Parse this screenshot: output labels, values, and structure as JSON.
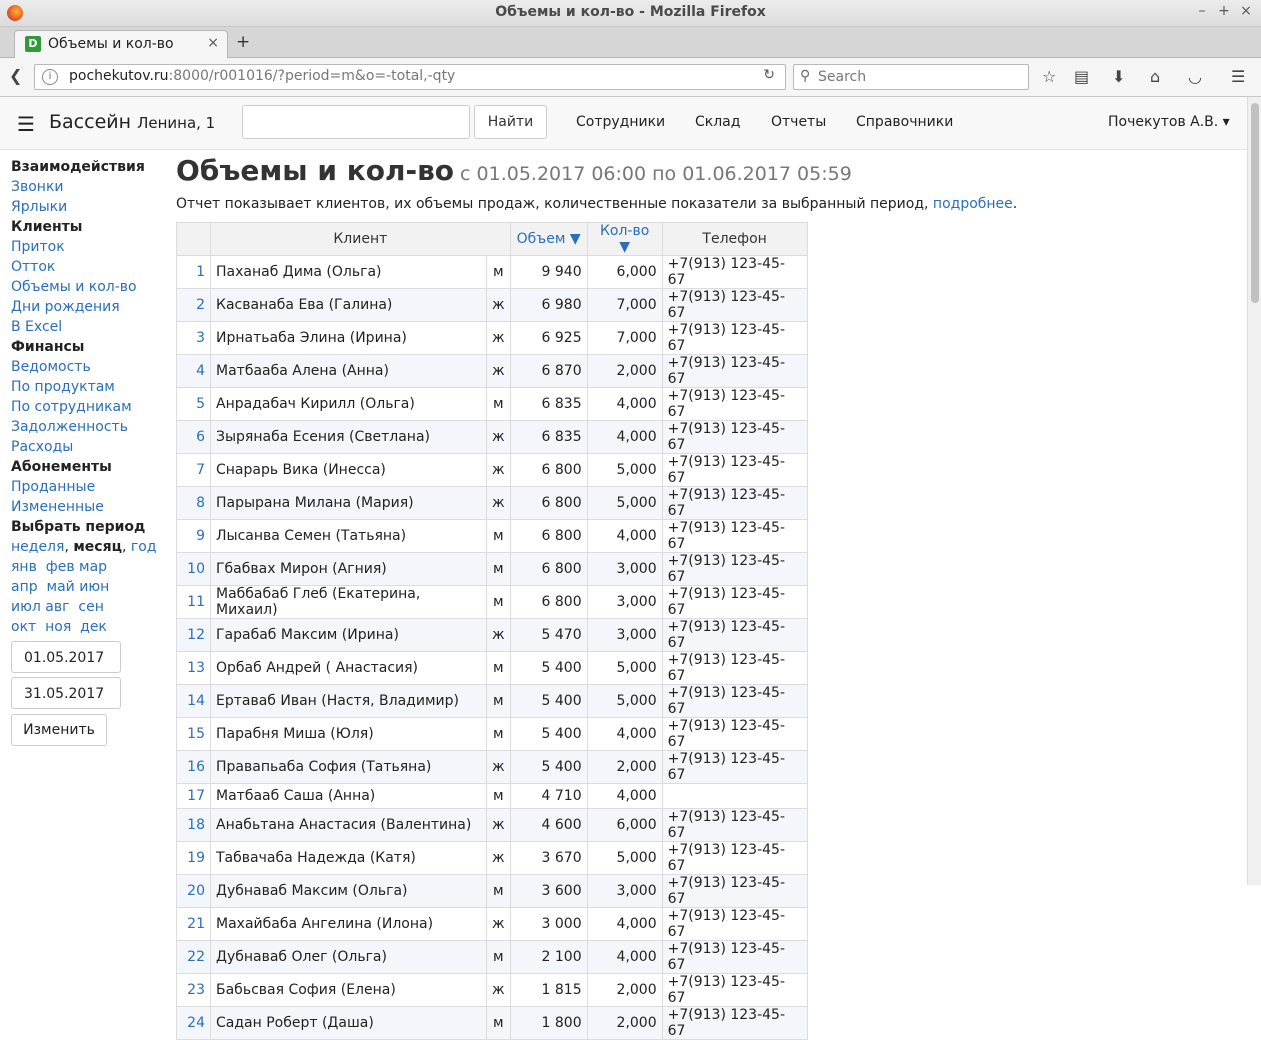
{
  "window": {
    "title": "Объемы и кол-во - Mozilla Firefox"
  },
  "tab": {
    "favicon": "D",
    "label": "Объемы и кол-во"
  },
  "nav": {
    "url_host": "pochekutov.ru",
    "url_rest": ":8000/r001016/?period=m&o=-total,-qty",
    "search_placeholder": "Search"
  },
  "app": {
    "brand": "Бассейн",
    "brand_sub": "Ленина, 1",
    "find_button": "Найти",
    "nav_items": [
      "Сотрудники",
      "Склад",
      "Отчеты",
      "Справочники"
    ],
    "user": "Почекутов А.В. ▾"
  },
  "sidebar": {
    "h_interactions": "Взаимодействия",
    "calls": "Звонки",
    "labels": "Ярлыки",
    "h_clients": "Клиенты",
    "inflow": "Приток",
    "outflow": "Отток",
    "volumes": "Объемы и кол-во",
    "birthdays": "Дни рождения",
    "excel": "В Excel",
    "h_finance": "Финансы",
    "statement": "Ведомость",
    "by_products": "По продуктам",
    "by_staff": "По сотрудникам",
    "debt": "Задолженность",
    "expenses": "Расходы",
    "h_subs": "Абонементы",
    "sold": "Проданные",
    "changed": "Измененные",
    "h_period": "Выбрать период",
    "period_week": "неделя",
    "period_month": "месяц",
    "period_year": "год",
    "m1": "янв",
    "m2": "фев",
    "m3": "мар",
    "m4": "апр",
    "m5": "май",
    "m6": "июн",
    "m7": "июл",
    "m8": "авг",
    "m9": "сен",
    "m10": "окт",
    "m11": "ноя",
    "m12": "дек",
    "date_from": "01.05.2017",
    "date_to": "31.05.2017",
    "change_button": "Изменить"
  },
  "main": {
    "title": "Объемы и кол-во",
    "period": "с 01.05.2017 06:00 по 01.06.2017 05:59",
    "desc": "Отчет показывает клиентов, их объемы продаж, количественные показатели за выбранный период,",
    "desc_link": "подробнее",
    "col_client": "Клиент",
    "col_volume": "Объем ▼",
    "col_qty": "Кол-во ▼",
    "col_phone": "Телефон",
    "rows": [
      {
        "n": "1",
        "name": "Паханаб Дима (Ольга)",
        "g": "м",
        "vol": "9 940",
        "qty": "6,000",
        "phone": "+7(913) 123-45-67"
      },
      {
        "n": "2",
        "name": "Касванаба Ева (Галина)",
        "g": "ж",
        "vol": "6 980",
        "qty": "7,000",
        "phone": "+7(913) 123-45-67"
      },
      {
        "n": "3",
        "name": "Ирнатьаба Элина (Ирина)",
        "g": "ж",
        "vol": "6 925",
        "qty": "7,000",
        "phone": "+7(913) 123-45-67"
      },
      {
        "n": "4",
        "name": "Матбааба Алена (Анна)",
        "g": "ж",
        "vol": "6 870",
        "qty": "2,000",
        "phone": "+7(913) 123-45-67"
      },
      {
        "n": "5",
        "name": "Анрадабач Кирилл (Ольга)",
        "g": "м",
        "vol": "6 835",
        "qty": "4,000",
        "phone": "+7(913) 123-45-67"
      },
      {
        "n": "6",
        "name": "Зырянаба Есения (Светлана)",
        "g": "ж",
        "vol": "6 835",
        "qty": "4,000",
        "phone": "+7(913) 123-45-67"
      },
      {
        "n": "7",
        "name": "Снарарь Вика (Инесса)",
        "g": "ж",
        "vol": "6 800",
        "qty": "5,000",
        "phone": "+7(913) 123-45-67"
      },
      {
        "n": "8",
        "name": "Парырана Милана (Мария)",
        "g": "ж",
        "vol": "6 800",
        "qty": "5,000",
        "phone": "+7(913) 123-45-67"
      },
      {
        "n": "9",
        "name": "Лысанва Семен (Татьяна)",
        "g": "м",
        "vol": "6 800",
        "qty": "4,000",
        "phone": "+7(913) 123-45-67"
      },
      {
        "n": "10",
        "name": "Гбабвах Мирон (Агния)",
        "g": "м",
        "vol": "6 800",
        "qty": "3,000",
        "phone": "+7(913) 123-45-67"
      },
      {
        "n": "11",
        "name": "Маббабаб Глеб (Екатерина, Михаил)",
        "g": "м",
        "vol": "6 800",
        "qty": "3,000",
        "phone": "+7(913) 123-45-67"
      },
      {
        "n": "12",
        "name": "Гарабаб Максим (Ирина)",
        "g": "ж",
        "vol": "5 470",
        "qty": "3,000",
        "phone": "+7(913) 123-45-67"
      },
      {
        "n": "13",
        "name": "Орбаб Андрей ( Анастасия)",
        "g": "м",
        "vol": "5 400",
        "qty": "5,000",
        "phone": "+7(913) 123-45-67"
      },
      {
        "n": "14",
        "name": "Ертаваб Иван (Настя, Владимир)",
        "g": "м",
        "vol": "5 400",
        "qty": "5,000",
        "phone": "+7(913) 123-45-67"
      },
      {
        "n": "15",
        "name": "Парабня Миша (Юля)",
        "g": "м",
        "vol": "5 400",
        "qty": "4,000",
        "phone": "+7(913) 123-45-67"
      },
      {
        "n": "16",
        "name": "Правапьаба София (Татьяна)",
        "g": "ж",
        "vol": "5 400",
        "qty": "2,000",
        "phone": "+7(913) 123-45-67"
      },
      {
        "n": "17",
        "name": "Матбааб Саша (Анна)",
        "g": "м",
        "vol": "4 710",
        "qty": "4,000",
        "phone": ""
      },
      {
        "n": "18",
        "name": "Анабьтана Анастасия (Валентина)",
        "g": "ж",
        "vol": "4 600",
        "qty": "6,000",
        "phone": "+7(913) 123-45-67"
      },
      {
        "n": "19",
        "name": "Табвачаба Надежда (Катя)",
        "g": "ж",
        "vol": "3 670",
        "qty": "5,000",
        "phone": "+7(913) 123-45-67"
      },
      {
        "n": "20",
        "name": "Дубнаваб Максим (Ольга)",
        "g": "м",
        "vol": "3 600",
        "qty": "3,000",
        "phone": "+7(913) 123-45-67"
      },
      {
        "n": "21",
        "name": "Махайбаба Ангелина (Илона)",
        "g": "ж",
        "vol": "3 000",
        "qty": "4,000",
        "phone": "+7(913) 123-45-67"
      },
      {
        "n": "22",
        "name": "Дубнаваб Олег (Ольга)",
        "g": "м",
        "vol": "2 100",
        "qty": "4,000",
        "phone": "+7(913) 123-45-67"
      },
      {
        "n": "23",
        "name": "Бабьсвая София (Елена)",
        "g": "ж",
        "vol": "1 815",
        "qty": "2,000",
        "phone": "+7(913) 123-45-67"
      },
      {
        "n": "24",
        "name": "Садан Роберт (Даша)",
        "g": "м",
        "vol": "1 800",
        "qty": "2,000",
        "phone": "+7(913) 123-45-67"
      }
    ]
  }
}
